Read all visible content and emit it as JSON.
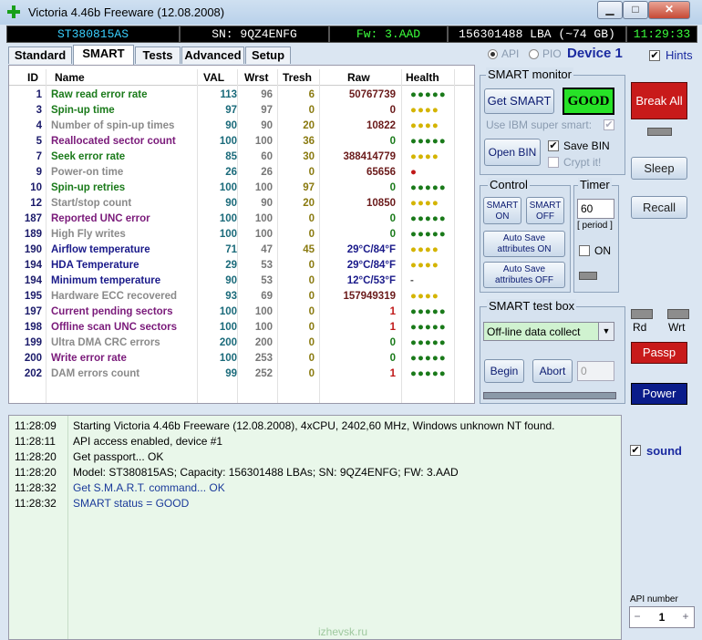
{
  "window": {
    "title": "Victoria 4.46b Freeware (12.08.2008)",
    "minimize": "▁",
    "maximize": "□",
    "close": "✕"
  },
  "status_bar": {
    "model": "ST380815AS",
    "serial": "SN: 9QZ4ENFG",
    "firmware": "Fw: 3.AAD",
    "capacity": "156301488 LBA (~74 GB)",
    "clock": "11:29:33"
  },
  "tabs": [
    "Standard",
    "SMART",
    "Tests",
    "Advanced",
    "Setup"
  ],
  "mode": {
    "api": "API",
    "pio": "PIO",
    "device": "Device 1",
    "hints": "Hints"
  },
  "table": {
    "headers": [
      "ID",
      "Name",
      "VAL",
      "Wrst",
      "Tresh",
      "Raw",
      "Health"
    ],
    "rows": [
      {
        "id": "1",
        "name": "Raw read error rate",
        "val": "113",
        "wrst": "96",
        "tresh": "6",
        "raw": "50767739",
        "health": "●●●●●",
        "name_color": "#1a7a1a",
        "raw_color": "#6a1a1a",
        "health_color": "#1a7a1a"
      },
      {
        "id": "3",
        "name": "Spin-up time",
        "val": "97",
        "wrst": "97",
        "tresh": "0",
        "raw": "0",
        "health": "●●●●",
        "name_color": "#1a7a1a",
        "raw_color": "#6a1a1a",
        "health_color": "#d4b400"
      },
      {
        "id": "4",
        "name": "Number of spin-up times",
        "val": "90",
        "wrst": "90",
        "tresh": "20",
        "raw": "10822",
        "health": "●●●●",
        "name_color": "#8a8a8a",
        "raw_color": "#6a1a1a",
        "health_color": "#d4b400"
      },
      {
        "id": "5",
        "name": "Reallocated sector count",
        "val": "100",
        "wrst": "100",
        "tresh": "36",
        "raw": "0",
        "health": "●●●●●",
        "name_color": "#7a1a7a",
        "raw_color": "#1a7a1a",
        "health_color": "#1a7a1a"
      },
      {
        "id": "7",
        "name": "Seek error rate",
        "val": "85",
        "wrst": "60",
        "tresh": "30",
        "raw": "388414779",
        "health": "●●●●",
        "name_color": "#1a7a1a",
        "raw_color": "#6a1a1a",
        "health_color": "#d4b400"
      },
      {
        "id": "9",
        "name": "Power-on time",
        "val": "26",
        "wrst": "26",
        "tresh": "0",
        "raw": "65656",
        "health": "●",
        "name_color": "#8a8a8a",
        "raw_color": "#6a1a1a",
        "health_color": "#c01818"
      },
      {
        "id": "10",
        "name": "Spin-up retries",
        "val": "100",
        "wrst": "100",
        "tresh": "97",
        "raw": "0",
        "health": "●●●●●",
        "name_color": "#1a7a1a",
        "raw_color": "#1a7a1a",
        "health_color": "#1a7a1a"
      },
      {
        "id": "12",
        "name": "Start/stop count",
        "val": "90",
        "wrst": "90",
        "tresh": "20",
        "raw": "10850",
        "health": "●●●●",
        "name_color": "#8a8a8a",
        "raw_color": "#6a1a1a",
        "health_color": "#d4b400"
      },
      {
        "id": "187",
        "name": "Reported UNC error",
        "val": "100",
        "wrst": "100",
        "tresh": "0",
        "raw": "0",
        "health": "●●●●●",
        "name_color": "#7a1a7a",
        "raw_color": "#1a7a1a",
        "health_color": "#1a7a1a"
      },
      {
        "id": "189",
        "name": "High Fly writes",
        "val": "100",
        "wrst": "100",
        "tresh": "0",
        "raw": "0",
        "health": "●●●●●",
        "name_color": "#8a8a8a",
        "raw_color": "#1a7a1a",
        "health_color": "#1a7a1a"
      },
      {
        "id": "190",
        "name": "Airflow temperature",
        "val": "71",
        "wrst": "47",
        "tresh": "45",
        "raw": "29°C/84°F",
        "health": "●●●●",
        "name_color": "#1a1a8a",
        "raw_color": "#1a1a8a",
        "health_color": "#d4b400"
      },
      {
        "id": "194",
        "name": "HDA Temperature",
        "val": "29",
        "wrst": "53",
        "tresh": "0",
        "raw": "29°C/84°F",
        "health": "●●●●",
        "name_color": "#1a1a8a",
        "raw_color": "#1a1a8a",
        "health_color": "#d4b400"
      },
      {
        "id": "194",
        "name": "Minimum temperature",
        "val": "90",
        "wrst": "53",
        "tresh": "0",
        "raw": "12°C/53°F",
        "health": "-",
        "name_color": "#1a1a8a",
        "raw_color": "#1a1a8a",
        "health_color": "#555555"
      },
      {
        "id": "195",
        "name": "Hardware ECC recovered",
        "val": "93",
        "wrst": "69",
        "tresh": "0",
        "raw": "157949319",
        "health": "●●●●",
        "name_color": "#8a8a8a",
        "raw_color": "#6a1a1a",
        "health_color": "#d4b400"
      },
      {
        "id": "197",
        "name": "Current pending sectors",
        "val": "100",
        "wrst": "100",
        "tresh": "0",
        "raw": "1",
        "health": "●●●●●",
        "name_color": "#7a1a7a",
        "raw_color": "#c01818",
        "health_color": "#1a7a1a"
      },
      {
        "id": "198",
        "name": "Offline scan UNC sectors",
        "val": "100",
        "wrst": "100",
        "tresh": "0",
        "raw": "1",
        "health": "●●●●●",
        "name_color": "#7a1a7a",
        "raw_color": "#c01818",
        "health_color": "#1a7a1a"
      },
      {
        "id": "199",
        "name": "Ultra DMA CRC errors",
        "val": "200",
        "wrst": "200",
        "tresh": "0",
        "raw": "0",
        "health": "●●●●●",
        "name_color": "#8a8a8a",
        "raw_color": "#1a7a1a",
        "health_color": "#1a7a1a"
      },
      {
        "id": "200",
        "name": "Write error rate",
        "val": "100",
        "wrst": "253",
        "tresh": "0",
        "raw": "0",
        "health": "●●●●●",
        "name_color": "#7a1a7a",
        "raw_color": "#1a7a1a",
        "health_color": "#1a7a1a"
      },
      {
        "id": "202",
        "name": "DAM errors count",
        "val": "99",
        "wrst": "252",
        "tresh": "0",
        "raw": "1",
        "health": "●●●●●",
        "name_color": "#8a8a8a",
        "raw_color": "#c01818",
        "health_color": "#1a7a1a"
      }
    ]
  },
  "smart_monitor": {
    "label": "SMART monitor",
    "get_smart": "Get SMART",
    "status": "GOOD",
    "ibm": "Use IBM super smart:",
    "open_bin": "Open BIN",
    "save_bin": "Save BIN",
    "crypt": "Crypt it!"
  },
  "control": {
    "label": "Control",
    "smart_on": "SMART ON",
    "smart_off": "SMART OFF",
    "autosave_on": "Auto Save attributes ON",
    "autosave_off": "Auto Save attributes OFF"
  },
  "timer": {
    "label": "Timer",
    "value": "60",
    "period": "[ period ]",
    "on": "ON"
  },
  "test_box": {
    "label": "SMART test box",
    "selected": "Off-line data collect",
    "begin": "Begin",
    "abort": "Abort",
    "value": "0"
  },
  "side": {
    "break_all": "Break All",
    "sleep": "Sleep",
    "recall": "Recall",
    "rd": "Rd",
    "wrt": "Wrt",
    "passp": "Passp",
    "power": "Power",
    "sound": "sound",
    "api_number_label": "API number",
    "api_number": "1",
    "minus": "−",
    "plus": "+"
  },
  "log": [
    {
      "time": "11:28:09",
      "msg": "Starting Victoria 4.46b Freeware (12.08.2008), 4xCPU, 2402,60 MHz, Windows unknown NT found.",
      "color": "#000000"
    },
    {
      "time": "11:28:11",
      "msg": "API access enabled, device #1",
      "color": "#000000"
    },
    {
      "time": "11:28:20",
      "msg": "Get passport... OK",
      "color": "#000000"
    },
    {
      "time": "11:28:20",
      "msg": "Model: ST380815AS; Capacity: 156301488 LBAs; SN: 9QZ4ENFG; FW: 3.AAD",
      "color": "#000000"
    },
    {
      "time": "11:28:32",
      "msg": "Get S.M.A.R.T. command... OK",
      "color": "#1a3a9a"
    },
    {
      "time": "11:28:32",
      "msg": "SMART status = GOOD",
      "color": "#1a3a9a"
    }
  ],
  "watermark": "izhevsk.ru",
  "colors": {
    "strip_model": "#39d0ff",
    "strip_serial": "#ffffff",
    "strip_fw": "#3cff3c",
    "strip_cap": "#ffffff",
    "strip_clock": "#3cff3c",
    "good": "#27e227",
    "break": "#c81a1a"
  }
}
